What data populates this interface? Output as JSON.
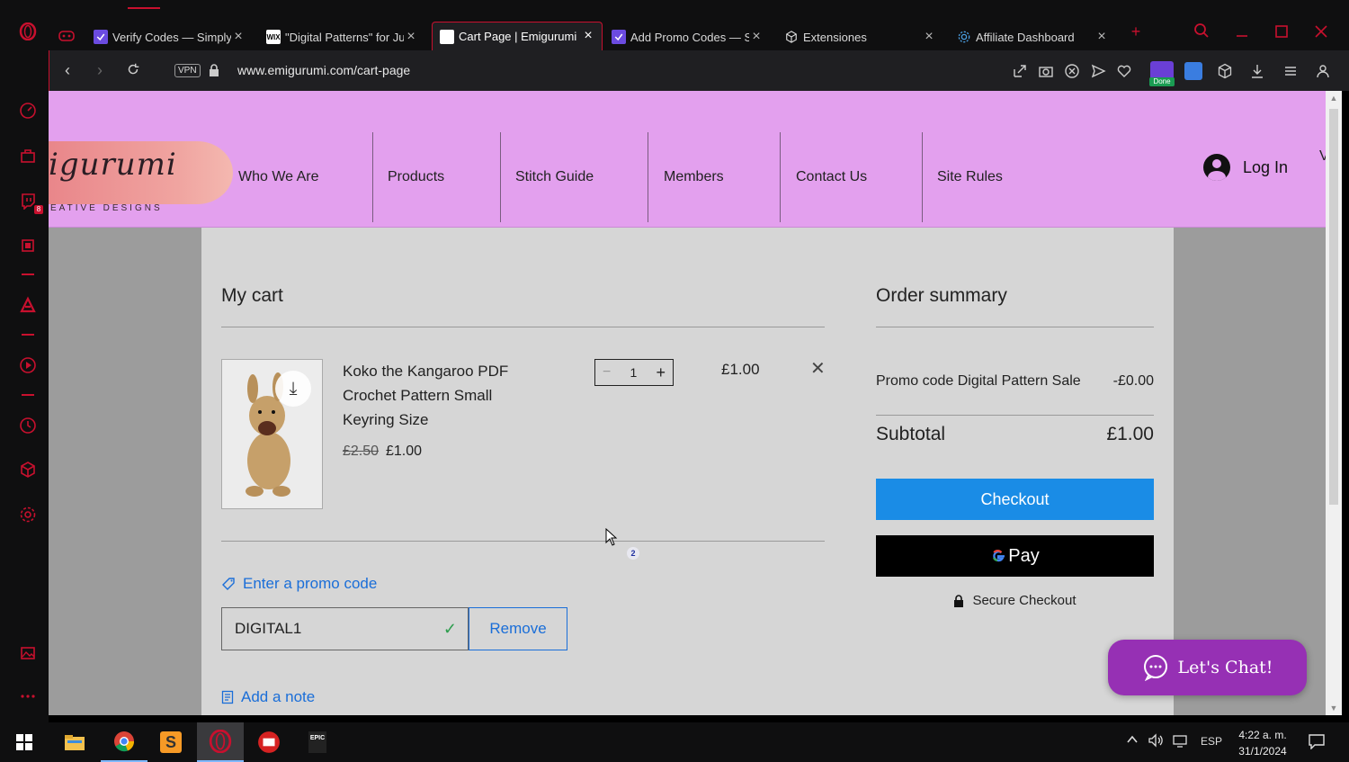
{
  "browser": {
    "tabs": [
      {
        "title": "Verify Codes — Simply",
        "favicon": "purple-check-icon"
      },
      {
        "title": "\"Digital Patterns\" for Ju",
        "favicon": "wix-icon"
      },
      {
        "title": "Cart Page | Emigurumi",
        "favicon": "page-icon",
        "active": true
      },
      {
        "title": "Add Promo Codes — S",
        "favicon": "purple-check-icon"
      },
      {
        "title": "Extensiones",
        "favicon": "cube-icon"
      },
      {
        "title": "Affiliate Dashboard",
        "favicon": "gear-icon"
      }
    ],
    "url": "www.emigurumi.com/cart-page",
    "vpn_label": "VPN",
    "ext_done_label": "Done"
  },
  "site": {
    "logo_text": "igurumi",
    "logo_sub": "EATIVE DESIGNS",
    "nav": [
      "Who We Are",
      "Products",
      "Stitch Guide",
      "Members",
      "Contact Us",
      "Site Rules"
    ],
    "login_label": "Log In",
    "header_trailing": "V"
  },
  "cart": {
    "title": "My cart",
    "item": {
      "name": "Koko the Kangaroo PDF Crochet Pattern Small Keyring Size",
      "price_old": "£2.50",
      "price_new": "£1.00",
      "quantity": "1",
      "line_total": "£1.00"
    },
    "promo_link": "Enter a promo code",
    "promo_value": "DIGITAL1",
    "remove_label": "Remove",
    "note_link": "Add a note"
  },
  "summary": {
    "title": "Order summary",
    "promo_label": "Promo code",
    "promo_name": "Digital Pattern Sale",
    "promo_amount": "-£0.00",
    "subtotal_label": "Subtotal",
    "subtotal_value": "£1.00",
    "checkout_label": "Checkout",
    "gpay_label": "Pay",
    "secure_label": "Secure Checkout"
  },
  "chat": {
    "label": "Let's Chat!"
  },
  "cursor_badge": "2",
  "taskbar": {
    "lang": "ESP",
    "time": "4:22 a. m.",
    "date": "31/1/2024",
    "sidebar_badge": "8",
    "epic_label": "EPIC"
  },
  "colors": {
    "accent": "#c8102e",
    "header_bg": "#e3a0ee",
    "checkout": "#1a8ce6",
    "link": "#1a6ed8",
    "chat": "#9630b4"
  }
}
